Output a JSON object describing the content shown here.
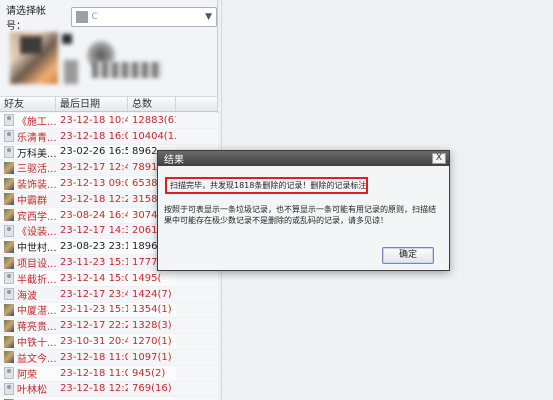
{
  "account": {
    "label": "请选择帐号：",
    "selected_value": "C"
  },
  "table": {
    "headers": [
      "好友",
      "最后日期",
      "总数",
      ""
    ],
    "rows": [
      {
        "name": "《施工...",
        "date": "23-12-18 10:40:06",
        "count": "12883(61)",
        "color": "red",
        "icon": "person"
      },
      {
        "name": "乐清青...",
        "date": "23-12-18 16:05:21",
        "count": "10404(1...",
        "color": "red",
        "icon": "person"
      },
      {
        "name": "万科美...",
        "date": "23-02-26 16:51:53",
        "count": "8962",
        "color": "black",
        "icon": "person"
      },
      {
        "name": "三驱活...",
        "date": "23-12-17 12:43:32",
        "count": "7891(",
        "color": "red",
        "icon": "pic"
      },
      {
        "name": "装饰装...",
        "date": "23-12-13 09:08:49",
        "count": "6538(",
        "color": "red",
        "icon": "pic"
      },
      {
        "name": "中霸群",
        "date": "23-12-18 12:26:03",
        "count": "3158(",
        "color": "red",
        "icon": "pic"
      },
      {
        "name": "宾西学...",
        "date": "23-08-24 16:43:52",
        "count": "3074(",
        "color": "red",
        "icon": "pic"
      },
      {
        "name": "《设装...",
        "date": "23-12-17 14:39:57",
        "count": "2061(",
        "color": "red",
        "icon": "person"
      },
      {
        "name": "中世村...",
        "date": "23-08-23 23:11:08",
        "count": "1896",
        "color": "black",
        "icon": "pic"
      },
      {
        "name": "项目设...",
        "date": "23-11-23 15:17:03",
        "count": "1777(",
        "color": "red",
        "icon": "pic"
      },
      {
        "name": "半截折...",
        "date": "23-12-14 15:03:36",
        "count": "1495(",
        "color": "red",
        "icon": "person"
      },
      {
        "name": "海波",
        "date": "23-12-17 23:48:39",
        "count": "1424(7)",
        "color": "red",
        "icon": "person"
      },
      {
        "name": "中厦湛...",
        "date": "23-11-23 15:17:03",
        "count": "1354(1)",
        "color": "red",
        "icon": "pic"
      },
      {
        "name": "蒋亮贵...",
        "date": "23-12-17 22:22:49",
        "count": "1328(3)",
        "color": "red",
        "icon": "pic"
      },
      {
        "name": "中铁十...",
        "date": "23-10-31 20:44:41",
        "count": "1270(1)",
        "color": "red",
        "icon": "pic"
      },
      {
        "name": "益文今...",
        "date": "23-12-18 11:04:03",
        "count": "1097(1)",
        "color": "red",
        "icon": "pic"
      },
      {
        "name": "阿荣",
        "date": "23-12-18 11:02:56",
        "count": "945(2)",
        "color": "red",
        "icon": "person"
      },
      {
        "name": "叶林松",
        "date": "23-12-18 12:26:17",
        "count": "769(16)",
        "color": "red",
        "icon": "person"
      },
      {
        "name": "B-06第...",
        "date": "23-10-31 15:21:31",
        "count": "761",
        "color": "black",
        "icon": "pic"
      }
    ]
  },
  "dialog": {
    "title": "结果",
    "close_label": "X",
    "highlight_text": "扫描完毕，共发现1818条删除的记录！删除的记录标注为红色！",
    "description": "按照于可表显示一条垃圾记录，也不算显示一条可能有用记录的原则，扫描结果中可能存在极少数记录不是删除的或乱码的记录，请多见谅！",
    "ok_label": "确定"
  },
  "colors": {
    "red_text": "#c62a2a",
    "highlight_border": "#e02020",
    "dialog_title_bg": "#4a4a4a"
  }
}
